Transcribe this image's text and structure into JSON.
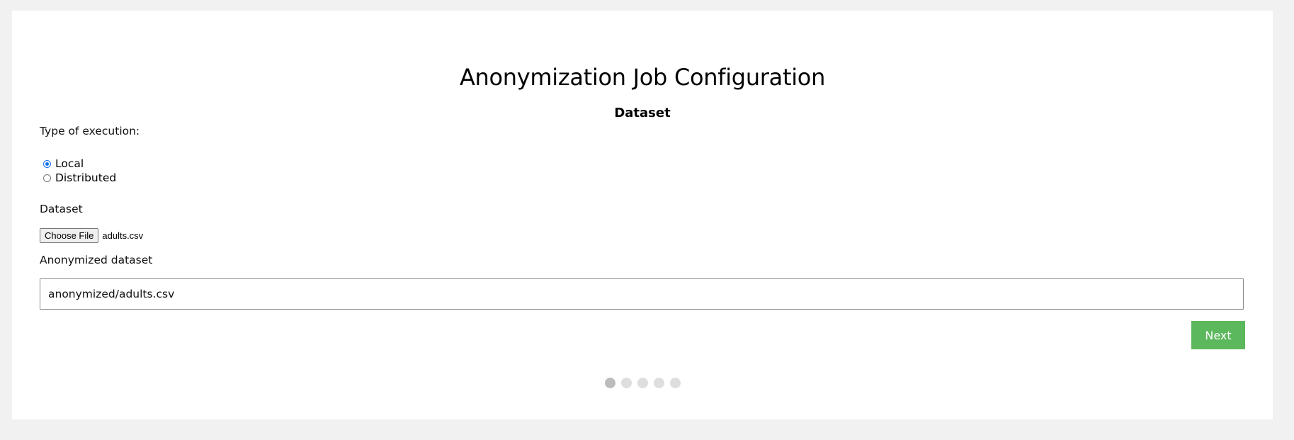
{
  "page": {
    "title": "Anonymization Job Configuration",
    "step_heading": "Dataset"
  },
  "execution": {
    "label": "Type of execution:",
    "options": [
      {
        "label": "Local",
        "checked": true
      },
      {
        "label": "Distributed",
        "checked": false
      }
    ]
  },
  "dataset": {
    "label": "Dataset",
    "choose_button": "Choose File",
    "file_name": "adults.csv"
  },
  "anonymized": {
    "label": "Anonymized dataset",
    "value": "anonymized/adults.csv"
  },
  "actions": {
    "next_label": "Next"
  },
  "stepper": {
    "total_steps": 5,
    "current_step": 1
  },
  "colors": {
    "page_background": "#f1f1f1",
    "card_background": "#ffffff",
    "next_button": "#5cb85c",
    "radio_accent": "#1a73e8",
    "dot_active": "#bcbcbc",
    "dot_inactive": "#dedede"
  }
}
